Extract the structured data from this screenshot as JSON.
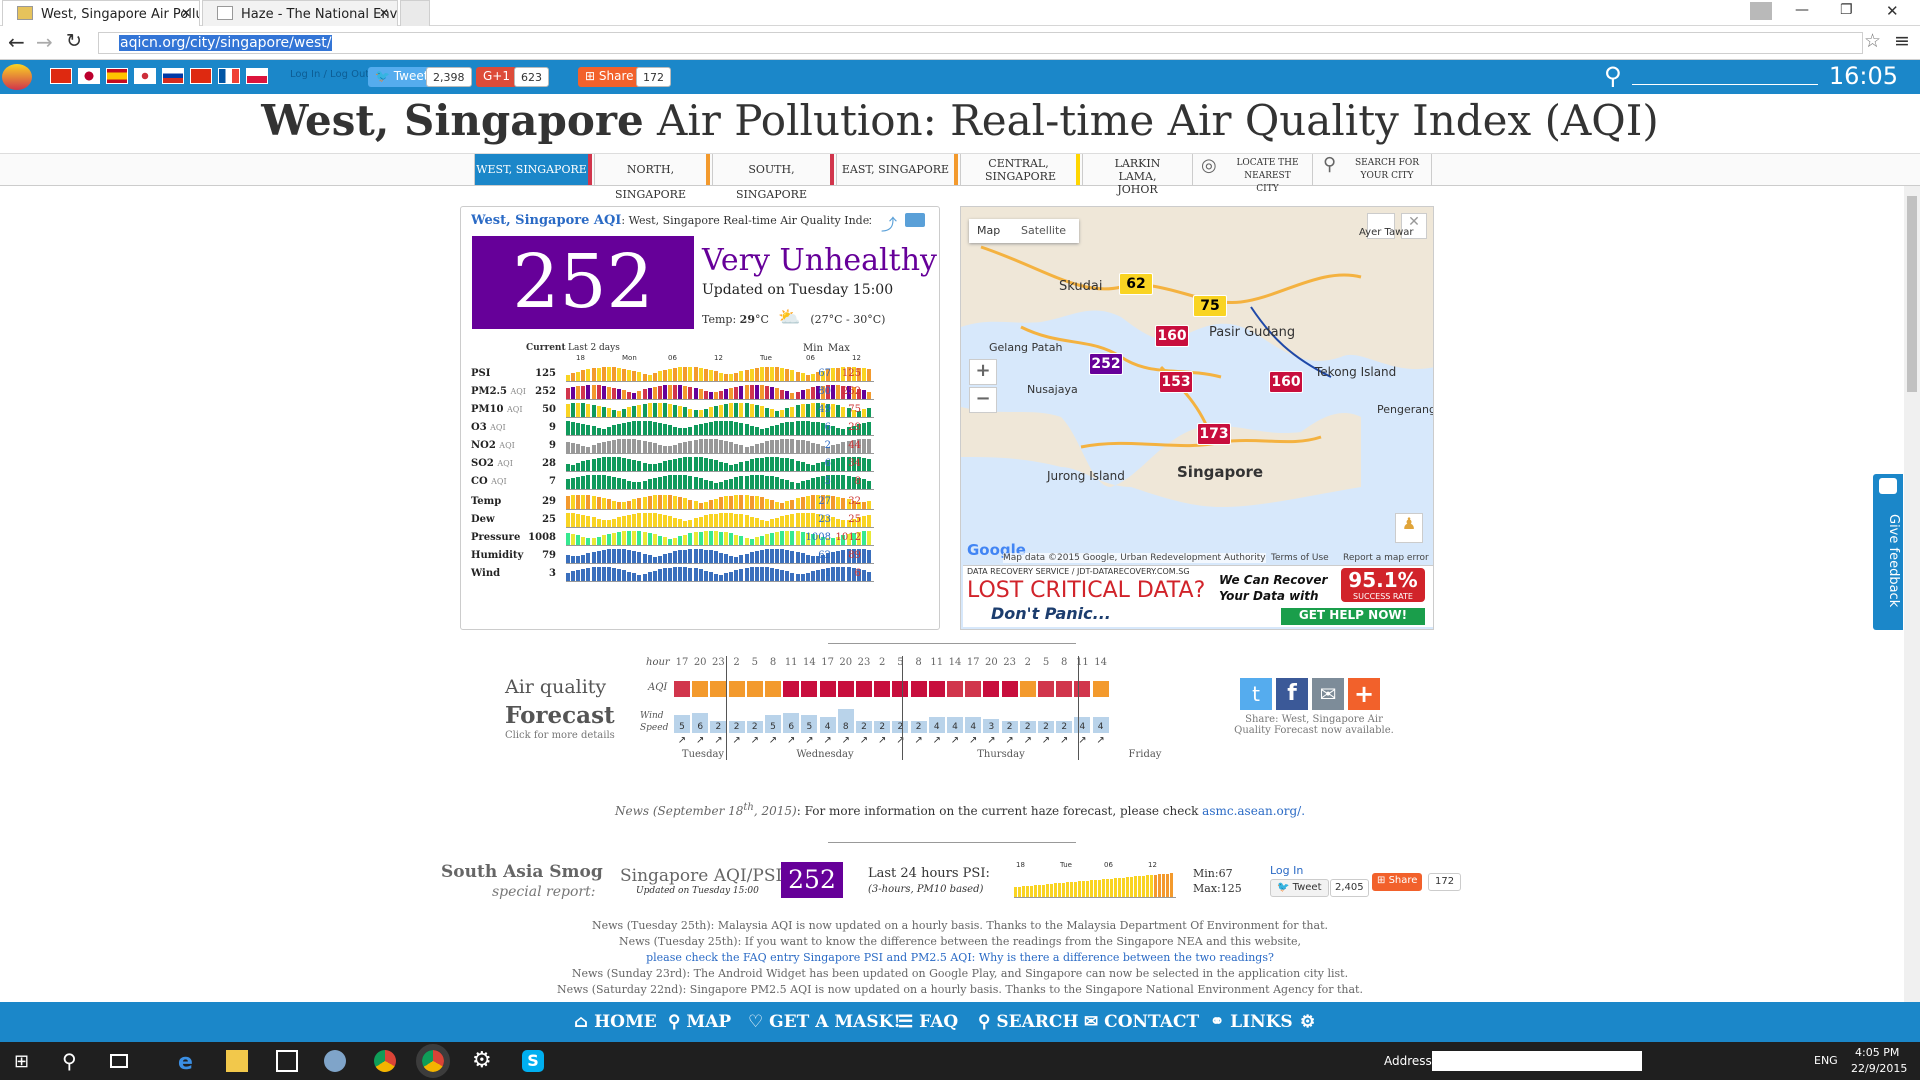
{
  "tabs": [
    {
      "label": "West, Singapore Air Pollut"
    },
    {
      "label": "Haze - The National Envir"
    }
  ],
  "address": {
    "url": "aqicn.org/city/singapore/west/"
  },
  "toolbar": {
    "login": "Log In / Log Out",
    "tweet": "Tweet",
    "tweet_count": "2,398",
    "gplus": "G+1",
    "gplus_count": "623",
    "share": "Share",
    "share_count": "172",
    "clock": "16:05"
  },
  "title": {
    "city": "West, Singapore",
    "rest": " Air Pollution: Real-time Air Quality Index (AQI)"
  },
  "city_nav": [
    {
      "label": "WEST, SINGAPORE",
      "color": "#d1354c"
    },
    {
      "label": "NORTH, SINGAPORE",
      "color": "#f39a2d"
    },
    {
      "label": "SOUTH, SINGAPORE",
      "color": "#d1354c"
    },
    {
      "label": "EAST, SINGAPORE",
      "color": "#f39a2d"
    },
    {
      "label": "CENTRAL, SINGAPORE",
      "color": "#ffd600"
    },
    {
      "label": "LARKIN LAMA, JOHOR",
      "color": "#ccc"
    },
    {
      "label": "LOCATE THE NEAREST CITY",
      "color": "#ccc"
    },
    {
      "label": "SEARCH FOR YOUR CITY",
      "color": "#ccc"
    }
  ],
  "aqi_widget": {
    "header_city": "West, Singapore AQI",
    "header_sub": ": West, Singapore Real-time Air Quality Index",
    "value": "252",
    "status": "Very Unhealthy",
    "status_color": "#660099",
    "updated": "Updated on Tuesday 15:00",
    "temp_label": "Temp:",
    "temp_value": "29",
    "temp_unit": "°C",
    "temp_range": "(27°C - 30°C)",
    "col_current": "Current",
    "col_last": "Last 2 days",
    "col_min": "Min",
    "col_max": "Max",
    "time_ticks": [
      "18",
      "Mon",
      "06",
      "12",
      "Tue",
      "06",
      "12"
    ],
    "rows": [
      {
        "name": "PSI",
        "aqi": "",
        "current": "125",
        "min": "67",
        "max": "125",
        "colors": [
          "#f9d423",
          "#f39a2d"
        ]
      },
      {
        "name": "PM2.5",
        "aqi": "AQI",
        "current": "252",
        "min": "80",
        "max": "252",
        "colors": [
          "#f39a2d",
          "#d1354c",
          "#660099"
        ]
      },
      {
        "name": "PM10",
        "aqi": "AQI",
        "current": "50",
        "min": "49",
        "max": "75",
        "colors": [
          "#f9d423",
          "#109a5c"
        ]
      },
      {
        "name": "O3",
        "aqi": "AQI",
        "current": "9",
        "min": "6",
        "max": "29",
        "colors": [
          "#109a5c"
        ]
      },
      {
        "name": "NO2",
        "aqi": "AQI",
        "current": "9",
        "min": "2",
        "max": "44",
        "colors": [
          "#999999"
        ]
      },
      {
        "name": "SO2",
        "aqi": "AQI",
        "current": "28",
        "min": "6",
        "max": "34",
        "colors": [
          "#109a5c"
        ]
      },
      {
        "name": "CO",
        "aqi": "AQI",
        "current": "7",
        "min": "5",
        "max": "8",
        "colors": [
          "#109a5c"
        ]
      },
      {
        "name": "Temp",
        "aqi": "",
        "current": "29",
        "min": "27",
        "max": "32",
        "colors": [
          "#f9d423",
          "#f39a2d"
        ]
      },
      {
        "name": "Dew",
        "aqi": "",
        "current": "25",
        "min": "23",
        "max": "25",
        "colors": [
          "#f9d423"
        ]
      },
      {
        "name": "Pressure",
        "aqi": "",
        "current": "1008",
        "min": "1008",
        "max": "1012",
        "colors": [
          "#e9e936",
          "#36e990"
        ]
      },
      {
        "name": "Humidity",
        "aqi": "",
        "current": "79",
        "min": "62",
        "max": "89",
        "colors": [
          "#3a6fbd"
        ]
      },
      {
        "name": "Wind",
        "aqi": "",
        "current": "3",
        "min": "1",
        "max": "6",
        "colors": [
          "#3a6fbd"
        ]
      }
    ]
  },
  "map": {
    "tab_map": "Map",
    "tab_sat": "Satellite",
    "labels": [
      "Skudai",
      "Pasir Gudang",
      "Gelang Patah",
      "Nusajaya",
      "Jurong Island",
      "Singapore",
      "Tekong Island",
      "Pengerang",
      "Ayer Tawar"
    ],
    "markers": [
      {
        "value": "62",
        "color": "#f9d423",
        "text_color": "#000"
      },
      {
        "value": "75",
        "color": "#f9d423",
        "text_color": "#000"
      },
      {
        "value": "160",
        "color": "#c80e3d",
        "text_color": "#fff"
      },
      {
        "value": "252",
        "color": "#660099",
        "text_color": "#fff"
      },
      {
        "value": "153",
        "color": "#c80e3d",
        "text_color": "#fff"
      },
      {
        "value": "160",
        "color": "#c80e3d",
        "text_color": "#fff"
      },
      {
        "value": "173",
        "color": "#c80e3d",
        "text_color": "#fff"
      }
    ],
    "attribution": "Map data ©2015 Google, Urban Redevelopment Authority",
    "terms": "Terms of Use",
    "report": "Report a map error",
    "ad_top": "DATA RECOVERY SERVICE / JDT-DATARECOVERY.COM.SG",
    "ad_title": "LOST CRITICAL DATA?",
    "ad_sub": "Don't Panic...",
    "ad_text": "We Can Recover Your Data with",
    "ad_rate": "95.1%",
    "ad_rate_label": "SUCCESS RATE",
    "ad_cta": "GET HELP NOW!"
  },
  "forecast": {
    "title1": "Air quality",
    "title2": "Forecast",
    "click": "Click for more details",
    "hour_label": "hour",
    "aqi_label": "AQI",
    "wind_label": "Wind Speed",
    "hours": [
      "17",
      "20",
      "23",
      "2",
      "5",
      "8",
      "11",
      "14",
      "17",
      "20",
      "23",
      "2",
      "5",
      "8",
      "11",
      "14",
      "17",
      "20",
      "23",
      "2",
      "5",
      "8",
      "11",
      "14"
    ],
    "aqi_colors": [
      "#d1354c",
      "#f39a2d",
      "#f39a2d",
      "#f39a2d",
      "#f39a2d",
      "#f39a2d",
      "#c80e3d",
      "#c80e3d",
      "#c80e3d",
      "#c80e3d",
      "#c80e3d",
      "#c80e3d",
      "#c80e3d",
      "#c80e3d",
      "#c80e3d",
      "#d1354c",
      "#d1354c",
      "#c80e3d",
      "#c80e3d",
      "#f39a2d",
      "#d1354c",
      "#d1354c",
      "#d1354c",
      "#f39a2d"
    ],
    "wind": [
      "5",
      "6",
      "2",
      "2",
      "2",
      "5",
      "6",
      "5",
      "4",
      "8",
      "2",
      "2",
      "2",
      "2",
      "4",
      "4",
      "4",
      "3",
      "2",
      "2",
      "2",
      "2",
      "4",
      "4"
    ],
    "days": [
      "Tuesday",
      "Wednesday",
      "Thursday",
      "Friday"
    ],
    "share_text": "Share: West, Singapore Air Quality Forecast now available."
  },
  "news_line": {
    "date": "News (September 18",
    "sup": "th",
    "year": ", 2015)",
    "text": ": For more information on the current haze forecast, please check ",
    "link": "asmc.asean.org/."
  },
  "smog": {
    "title": "South Asia Smog",
    "sub": "special report:",
    "label": "Singapore AQI/PSI:",
    "updated": "Updated on Tuesday 15:00",
    "value": "252",
    "psi_label": "Last 24 hours PSI:",
    "psi_sub": "(3-hours, PM10 based)",
    "ticks": [
      "18",
      "Tue",
      "06",
      "12"
    ],
    "min": "Min:67",
    "max": "Max:125",
    "login": "Log In",
    "tweet": "Tweet",
    "tweet_count": "2,405",
    "share": "Share",
    "share_count": "172"
  },
  "news": [
    {
      "text": "News (Tuesday 25th): Malaysia AQI is now updated on a hourly basis. Thanks to the Malaysia Department Of Environment for that."
    },
    {
      "text": "News (Tuesday 25th): If you want to know the difference between the readings from the Singapore NEA and this website,"
    },
    {
      "text": "please check the FAQ entry Singapore PSI and PM2.5 AQI: Why is there a difference between the two readings?"
    },
    {
      "text": "News (Sunday 23rd): The Android Widget has been updated on Google Play, and Singapore can now be selected in the application city list."
    },
    {
      "text": "News (Saturday 22nd): Singapore PM2.5 AQI is now updated on a hourly basis. Thanks to the Singapore National Environment Agency for that."
    }
  ],
  "bottom_nav": [
    "HOME",
    "MAP",
    "GET A MASK!",
    "FAQ",
    "SEARCH",
    "CONTACT",
    "LINKS"
  ],
  "feedback": "Give feedback",
  "taskbar": {
    "address_label": "Address",
    "lang": "ENG",
    "time": "4:05 PM",
    "date": "22/9/2015"
  }
}
